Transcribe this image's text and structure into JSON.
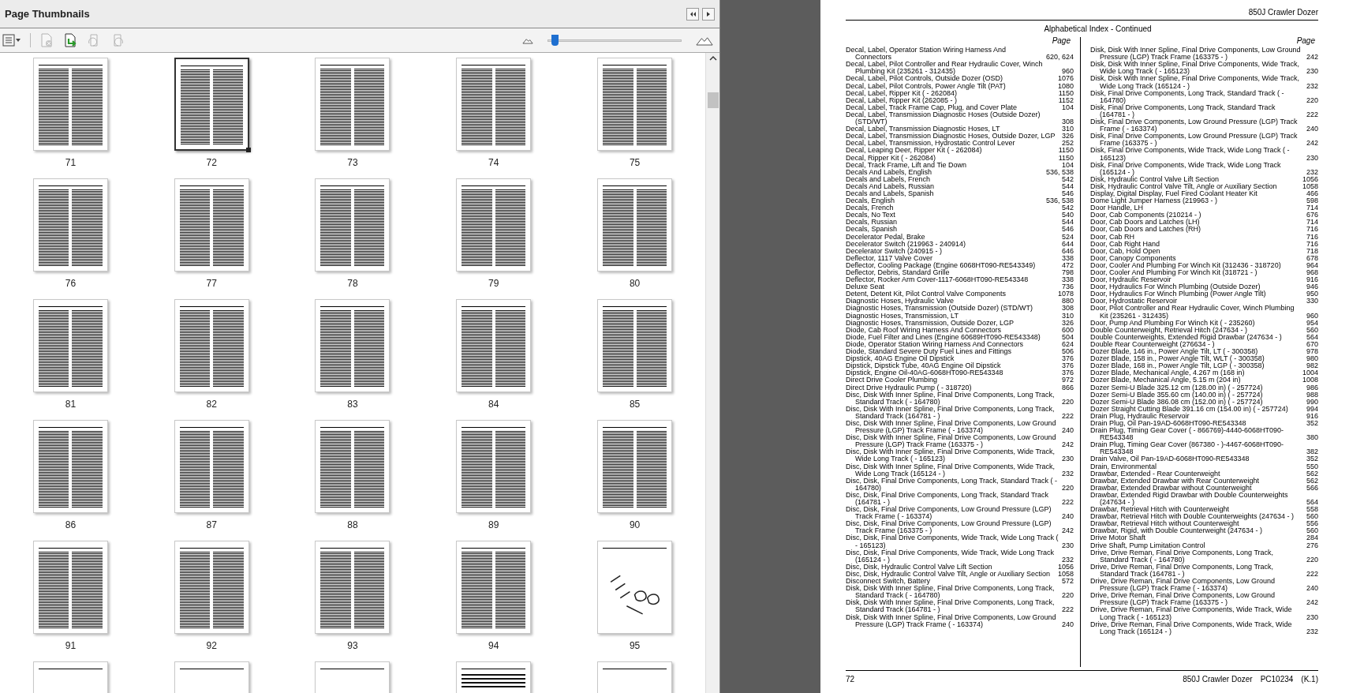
{
  "panel": {
    "title": "Page Thumbnails",
    "zoom_slider": {
      "level": 0.05
    },
    "thumbnails": [
      {
        "label": "71",
        "kind": "text",
        "selected": false
      },
      {
        "label": "72",
        "kind": "text",
        "selected": true
      },
      {
        "label": "73",
        "kind": "text",
        "selected": false
      },
      {
        "label": "74",
        "kind": "text",
        "selected": false
      },
      {
        "label": "75",
        "kind": "text",
        "selected": false
      },
      {
        "label": "76",
        "kind": "text",
        "selected": false
      },
      {
        "label": "77",
        "kind": "text",
        "selected": false
      },
      {
        "label": "78",
        "kind": "text",
        "selected": false
      },
      {
        "label": "79",
        "kind": "text",
        "selected": false
      },
      {
        "label": "80",
        "kind": "text",
        "selected": false
      },
      {
        "label": "81",
        "kind": "text",
        "selected": false
      },
      {
        "label": "82",
        "kind": "text",
        "selected": false
      },
      {
        "label": "83",
        "kind": "text",
        "selected": false
      },
      {
        "label": "84",
        "kind": "text",
        "selected": false
      },
      {
        "label": "85",
        "kind": "text",
        "selected": false
      },
      {
        "label": "86",
        "kind": "text",
        "selected": false
      },
      {
        "label": "87",
        "kind": "text",
        "selected": false
      },
      {
        "label": "88",
        "kind": "text",
        "selected": false
      },
      {
        "label": "89",
        "kind": "text",
        "selected": false
      },
      {
        "label": "90",
        "kind": "text",
        "selected": false
      },
      {
        "label": "91",
        "kind": "text",
        "selected": false
      },
      {
        "label": "92",
        "kind": "text",
        "selected": false
      },
      {
        "label": "93",
        "kind": "text",
        "selected": false
      },
      {
        "label": "94",
        "kind": "text",
        "selected": false
      },
      {
        "label": "95",
        "kind": "drawing",
        "selected": false
      },
      {
        "kind": "blank",
        "selected": false
      },
      {
        "kind": "drawing",
        "selected": false
      },
      {
        "kind": "drawing",
        "selected": false
      },
      {
        "kind": "table",
        "selected": false
      },
      {
        "kind": "drawing",
        "selected": false
      }
    ]
  },
  "document_page": {
    "header": "850J Crawler Dozer",
    "title": "Alphabetical Index - Continued",
    "columns": [
      {
        "page_heading": "Page",
        "entries": [
          {
            "entry": "Decal, Label, Operator Station Wiring Harness And Connectors",
            "page": "620, 624"
          },
          {
            "entry": "Decal, Label, Pilot Controller and Rear Hydraulic Cover, Winch Plumbing Kit (235261 - 312435)",
            "page": "960"
          },
          {
            "entry": "Decal, Label, Pilot Controls, Outside Dozer (OSD)",
            "page": "1076"
          },
          {
            "entry": "Decal, Label, Pilot Controls, Power Angle Tilt (PAT)",
            "page": "1080"
          },
          {
            "entry": "Decal, Label, Ripper Kit ( - 262084)",
            "page": "1150"
          },
          {
            "entry": "Decal, Label, Ripper Kit (262085 - )",
            "page": "1152"
          },
          {
            "entry": "Decal, Label, Track Frame Cap, Plug, and Cover Plate",
            "page": "104"
          },
          {
            "entry": "Decal, Label, Transmission Diagnostic Hoses (Outside Dozer) (STD/WT)",
            "page": "308"
          },
          {
            "entry": "Decal, Label, Transmission Diagnostic Hoses, LT",
            "page": "310"
          },
          {
            "entry": "Decal, Label, Transmission Diagnostic Hoses, Outside Dozer, LGP",
            "page": "326"
          },
          {
            "entry": "Decal, Label, Transmission, Hydrostatic Control Lever",
            "page": "252"
          },
          {
            "entry": "Decal, Leaping Deer, Ripper Kit ( - 262084)",
            "page": "1150"
          },
          {
            "entry": "Decal, Ripper Kit ( - 262084)",
            "page": "1150"
          },
          {
            "entry": "Decal, Track Frame, Lift and Tie Down",
            "page": "104"
          },
          {
            "entry": "Decals And Labels, English",
            "page": "536, 538"
          },
          {
            "entry": "Decals and Labels, French",
            "page": "542"
          },
          {
            "entry": "Decals And Labels, Russian",
            "page": "544"
          },
          {
            "entry": "Decals and Labels, Spanish",
            "page": "546"
          },
          {
            "entry": "Decals, English",
            "page": "536, 538"
          },
          {
            "entry": "Decals, French",
            "page": "542"
          },
          {
            "entry": "Decals, No Text",
            "page": "540"
          },
          {
            "entry": "Decals, Russian",
            "page": "544"
          },
          {
            "entry": "Decals, Spanish",
            "page": "546"
          },
          {
            "entry": "Decelerator Pedal, Brake",
            "page": "524"
          },
          {
            "entry": "Decelerator Switch (219963 - 240914)",
            "page": "644"
          },
          {
            "entry": "Decelerator Switch (240915 - )",
            "page": "646"
          },
          {
            "entry": "Deflector, 1117 Valve Cover",
            "page": "338"
          },
          {
            "entry": "Deflector, Cooling Package (Engine 6068HT090-RE543349)",
            "page": "472"
          },
          {
            "entry": "Deflector, Debris, Standard Grille",
            "page": "798"
          },
          {
            "entry": "Deflector, Rocker Arm Cover-1117-6068HT090-RE543348",
            "page": "338"
          },
          {
            "entry": "Deluxe Seat",
            "page": "736"
          },
          {
            "entry": "Detent, Detent Kit, Pilot Control Valve Components",
            "page": "1078"
          },
          {
            "entry": "Diagnostic Hoses, Hydraulic Valve",
            "page": "880"
          },
          {
            "entry": "Diagnostic Hoses, Transmission (Outside Dozer) (STD/WT)",
            "page": "308"
          },
          {
            "entry": "Diagnostic Hoses, Transmission, LT",
            "page": "310"
          },
          {
            "entry": "Diagnostic Hoses, Transmission, Outside Dozer, LGP",
            "page": "326"
          },
          {
            "entry": "Diode, Cab Roof Wiring Harness And Connectors",
            "page": "600"
          },
          {
            "entry": "Diode, Fuel Filter and Lines (Engine 60689HT090-RE543348)",
            "page": "504"
          },
          {
            "entry": "Diode, Operator Station Wiring Harness And Connectors",
            "page": "624"
          },
          {
            "entry": "Diode, Standard Severe Duty Fuel Lines and Fittings",
            "page": "506"
          },
          {
            "entry": "Dipstick, 40AG Engine Oil Dipstick",
            "page": "376"
          },
          {
            "entry": "Dipstick, Dipstick Tube, 40AG Engine Oil Dipstick",
            "page": "376"
          },
          {
            "entry": "Dipstick, Engine Oil-40AG-6068HT090-RE543348",
            "page": "376"
          },
          {
            "entry": "Direct Drive Cooler Plumbing",
            "page": "972"
          },
          {
            "entry": "Direct Drive Hydraulic Pump ( - 318720)",
            "page": "866"
          },
          {
            "entry": "Disc, Disk With Inner Spline, Final Drive Components, Long Track, Standard Track ( - 164780)",
            "page": "220"
          },
          {
            "entry": "Disc, Disk With Inner Spline, Final Drive Components, Long Track, Standard Track (164781 - )",
            "page": "222"
          },
          {
            "entry": "Disc, Disk With Inner Spline, Final Drive Components, Low Ground Pressure (LGP) Track Frame ( - 163374)",
            "page": "240"
          },
          {
            "entry": "Disc, Disk With Inner Spline, Final Drive Components, Low Ground Pressure (LGP) Track Frame (163375 - )",
            "page": "242"
          },
          {
            "entry": "Disc, Disk With Inner Spline, Final Drive Components, Wide Track, Wide Long Track ( - 165123)",
            "page": "230"
          },
          {
            "entry": "Disc, Disk With Inner Spline, Final Drive Components, Wide Track, Wide Long Track (165124 - )",
            "page": "232"
          },
          {
            "entry": "Disc, Disk, Final Drive Components, Long Track, Standard Track ( - 164780)",
            "page": "220"
          },
          {
            "entry": "Disc, Disk, Final Drive Components, Long Track, Standard Track (164781 - )",
            "page": "222"
          },
          {
            "entry": "Disc, Disk, Final Drive Components, Low Ground Pressure (LGP) Track Frame ( - 163374)",
            "page": "240"
          },
          {
            "entry": "Disc, Disk, Final Drive Components, Low Ground Pressure (LGP) Track Frame (163375 - )",
            "page": "242"
          },
          {
            "entry": "Disc, Disk, Final Drive Components, Wide Track, Wide Long Track ( - 165123)",
            "page": "230"
          },
          {
            "entry": "Disc, Disk, Final Drive Components, Wide Track, Wide Long Track (165124 - )",
            "page": "232"
          },
          {
            "entry": "Disc, Disk, Hydraulic Control Valve Lift Section",
            "page": "1056"
          },
          {
            "entry": "Disc, Disk, Hydraulic Control Valve Tilt, Angle or Auxiliary Section",
            "page": "1058"
          },
          {
            "entry": "Disconnect Switch, Battery",
            "page": "572"
          },
          {
            "entry": "Disk, Disk With Inner Spline, Final Drive Components, Long Track, Standard Track ( - 164780)",
            "page": "220"
          },
          {
            "entry": "Disk, Disk With Inner Spline, Final Drive Components, Long Track, Standard Track (164781 - )",
            "page": "222"
          },
          {
            "entry": "Disk, Disk With Inner Spline, Final Drive Components, Low Ground Pressure (LGP) Track Frame ( - 163374)",
            "page": "240"
          }
        ]
      },
      {
        "page_heading": "Page",
        "entries": [
          {
            "entry": "Disk, Disk With Inner Spline, Final Drive Components, Low Ground Pressure (LGP) Track Frame (163375 - )",
            "page": "242"
          },
          {
            "entry": "Disk, Disk With Inner Spline, Final Drive Components, Wide Track, Wide Long Track ( - 165123)",
            "page": "230"
          },
          {
            "entry": "Disk, Disk With Inner Spline, Final Drive Components, Wide Track, Wide Long Track (165124 - )",
            "page": "232"
          },
          {
            "entry": "Disk, Final Drive Components, Long Track, Standard Track ( - 164780)",
            "page": "220"
          },
          {
            "entry": "Disk, Final Drive Components, Long Track, Standard Track (164781 - )",
            "page": "222"
          },
          {
            "entry": "Disk, Final Drive Components, Low Ground Pressure (LGP) Track Frame ( - 163374)",
            "page": "240"
          },
          {
            "entry": "Disk, Final Drive Components, Low Ground Pressure (LGP) Track Frame (163375 - )",
            "page": "242"
          },
          {
            "entry": "Disk, Final Drive Components, Wide Track, Wide Long Track ( - 165123)",
            "page": "230"
          },
          {
            "entry": "Disk, Final Drive Components, Wide Track, Wide Long Track (165124 - )",
            "page": "232"
          },
          {
            "entry": "Disk, Hydraulic Control Valve Lift Section",
            "page": "1056"
          },
          {
            "entry": "Disk, Hydraulic Control Valve Tilt, Angle or Auxiliary Section",
            "page": "1058"
          },
          {
            "entry": "Display, Digital Display, Fuel Fired Coolant Heater Kit",
            "page": "466"
          },
          {
            "entry": "Dome Light Jumper Harness (219963 - )",
            "page": "598"
          },
          {
            "entry": "Door Handle, LH",
            "page": "714"
          },
          {
            "entry": "Door, Cab Components (210214 - )",
            "page": "676"
          },
          {
            "entry": "Door, Cab Doors and Latches (LH)",
            "page": "714"
          },
          {
            "entry": "Door, Cab Doors and Latches (RH)",
            "page": "716"
          },
          {
            "entry": "Door, Cab RH",
            "page": "716"
          },
          {
            "entry": "Door, Cab Right Hand",
            "page": "716"
          },
          {
            "entry": "Door, Cab, Hold Open",
            "page": "718"
          },
          {
            "entry": "Door, Canopy Components",
            "page": "678"
          },
          {
            "entry": "Door, Cooler And Plumbing For Winch Kit (312436 - 318720)",
            "page": "964"
          },
          {
            "entry": "Door, Cooler And Plumbing For Winch Kit (318721 - )",
            "page": "968"
          },
          {
            "entry": "Door, Hydraulic Reservoir",
            "page": "916"
          },
          {
            "entry": "Door, Hydraulics For Winch Plumbing (Outside Dozer)",
            "page": "946"
          },
          {
            "entry": "Door, Hydraulics For Winch Plumbing (Power Angle Tilt)",
            "page": "950"
          },
          {
            "entry": "Door, Hydrostatic Reservoir",
            "page": "330"
          },
          {
            "entry": "Door, Pilot Controller and Rear Hydraulic Cover, Winch Plumbing Kit (235261 - 312435)",
            "page": "960"
          },
          {
            "entry": "Door, Pump And Plumbing For Winch Kit ( - 235260)",
            "page": "954"
          },
          {
            "entry": "Double Counterweight, Retrieval Hitch (247634 - )",
            "page": "560"
          },
          {
            "entry": "Double Counterweights, Extended Rigid Drawbar (247634 - )",
            "page": "564"
          },
          {
            "entry": "Double Rear Counterweight (276634 - )",
            "page": "670"
          },
          {
            "entry": "Dozer Blade, 146 in., Power Angle Tilt, LT ( - 300358)",
            "page": "978"
          },
          {
            "entry": "Dozer Blade, 158 in., Power Angle Tilt, WLT ( - 300358)",
            "page": "980"
          },
          {
            "entry": "Dozer Blade, 168 in., Power Angle Tilt, LGP ( - 300358)",
            "page": "982"
          },
          {
            "entry": "Dozer Blade, Mechanical Angle, 4.267 m (168 in)",
            "page": "1004"
          },
          {
            "entry": "Dozer Blade, Mechanical Angle, 5.15 m (204 in)",
            "page": "1008"
          },
          {
            "entry": "Dozer Semi-U Blade 325.12 cm (128.00 in) ( - 257724)",
            "page": "986"
          },
          {
            "entry": "Dozer Semi-U Blade 355.60 cm (140.00 in) ( - 257724)",
            "page": "988"
          },
          {
            "entry": "Dozer Semi-U Blade 386.08 cm (152.00 in) ( - 257724)",
            "page": "990"
          },
          {
            "entry": "Dozer Straight Cutting Blade 391.16 cm (154.00 in) ( - 257724)",
            "page": "994"
          },
          {
            "entry": "Drain Plug, Hydraulic Reservoir",
            "page": "916"
          },
          {
            "entry": "Drain Plug, Oil Pan-19AD-6068HT090-RE543348",
            "page": "352"
          },
          {
            "entry": "Drain Plug, Timing Gear Cover ( - 866769)-4440-6068HT090-RE543348",
            "page": "380"
          },
          {
            "entry": "Drain Plug, Timing Gear Cover (867380 - )-4467-6068HT090-RE543348",
            "page": "382"
          },
          {
            "entry": "Drain Valve, Oil Pan-19AD-6068HT090-RE543348",
            "page": "352"
          },
          {
            "entry": "Drain, Environmental",
            "page": "550"
          },
          {
            "entry": "Drawbar, Extended - Rear Counterweight",
            "page": "562"
          },
          {
            "entry": "Drawbar, Extended Drawbar with Rear Counterweight",
            "page": "562"
          },
          {
            "entry": "Drawbar, Extended Drawbar without Counterweight",
            "page": "566"
          },
          {
            "entry": "Drawbar, Extended Rigid Drawbar with Double Counterweights (247634 - )",
            "page": "564"
          },
          {
            "entry": "Drawbar, Retrieval Hitch with Counterweight",
            "page": "558"
          },
          {
            "entry": "Drawbar, Retrieval Hitch with Double Counterweights (247634 - )",
            "page": "560"
          },
          {
            "entry": "Drawbar, Retrieval Hitch without Counterweight",
            "page": "556"
          },
          {
            "entry": "Drawbar, Rigid, with Double Counterweight (247634 - )",
            "page": "560"
          },
          {
            "entry": "Drive Motor Shaft",
            "page": "284"
          },
          {
            "entry": "Drive Shaft, Pump Limitation Control",
            "page": "276"
          },
          {
            "entry": "Drive, Drive Reman, Final Drive Components, Long Track, Standard Track ( - 164780)",
            "page": "220"
          },
          {
            "entry": "Drive, Drive Reman, Final Drive Components, Long Track, Standard Track (164781 - )",
            "page": "222"
          },
          {
            "entry": "Drive, Drive Reman, Final Drive Components, Low Ground Pressure (LGP) Track Frame ( - 163374)",
            "page": "240"
          },
          {
            "entry": "Drive, Drive Reman, Final Drive Components, Low Ground Pressure (LGP) Track Frame (163375 - )",
            "page": "242"
          },
          {
            "entry": "Drive, Drive Reman, Final Drive Components, Wide Track, Wide Long Track ( - 165123)",
            "page": "230"
          },
          {
            "entry": "Drive, Drive Reman, Final Drive Components, Wide Track, Wide Long Track (165124 - )",
            "page": "232"
          }
        ]
      }
    ],
    "footer": {
      "page_number": "72",
      "document": "850J Crawler Dozer",
      "code": "PC10234",
      "revision": "(K.1)"
    }
  }
}
